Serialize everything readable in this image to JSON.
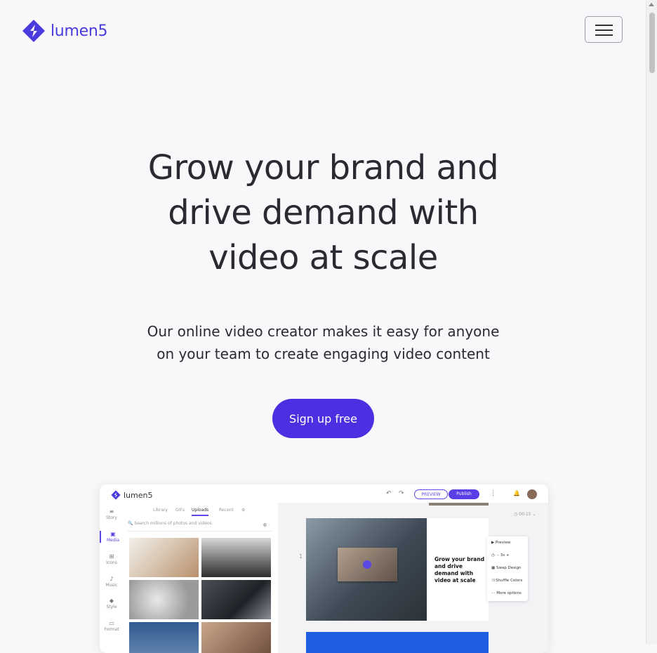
{
  "header": {
    "logo_text": "lumen5",
    "menu_icon": "hamburger-icon"
  },
  "hero": {
    "title_lines": [
      "Grow your brand and",
      "drive demand with",
      "video at scale"
    ],
    "subtitle_lines": [
      "Our online video creator makes it easy for anyone",
      "on your team to create engaging video content"
    ],
    "cta_label": "Sign up free"
  },
  "mockup": {
    "logo_text": "lumen5",
    "preview_label": "PREVIEW",
    "publish_label": "Publish",
    "sidebar": [
      "Story",
      "Media",
      "Icons",
      "Music",
      "Style",
      "Format"
    ],
    "tabs": [
      "Library",
      "GIFs",
      "Uploads",
      "Recent"
    ],
    "search_placeholder": "Search millions of photos and videos",
    "slide_number": "1",
    "slide_text": "Grow your brand and drive demand with video at scale",
    "duration": "00:15",
    "stepper_value": "3s",
    "context_menu": [
      "Preview",
      "Swap Design",
      "Shuffle Colors",
      "More options"
    ]
  },
  "colors": {
    "brand": "#4a30e0",
    "background": "#f8f8fa",
    "text": "#2a2a32"
  }
}
